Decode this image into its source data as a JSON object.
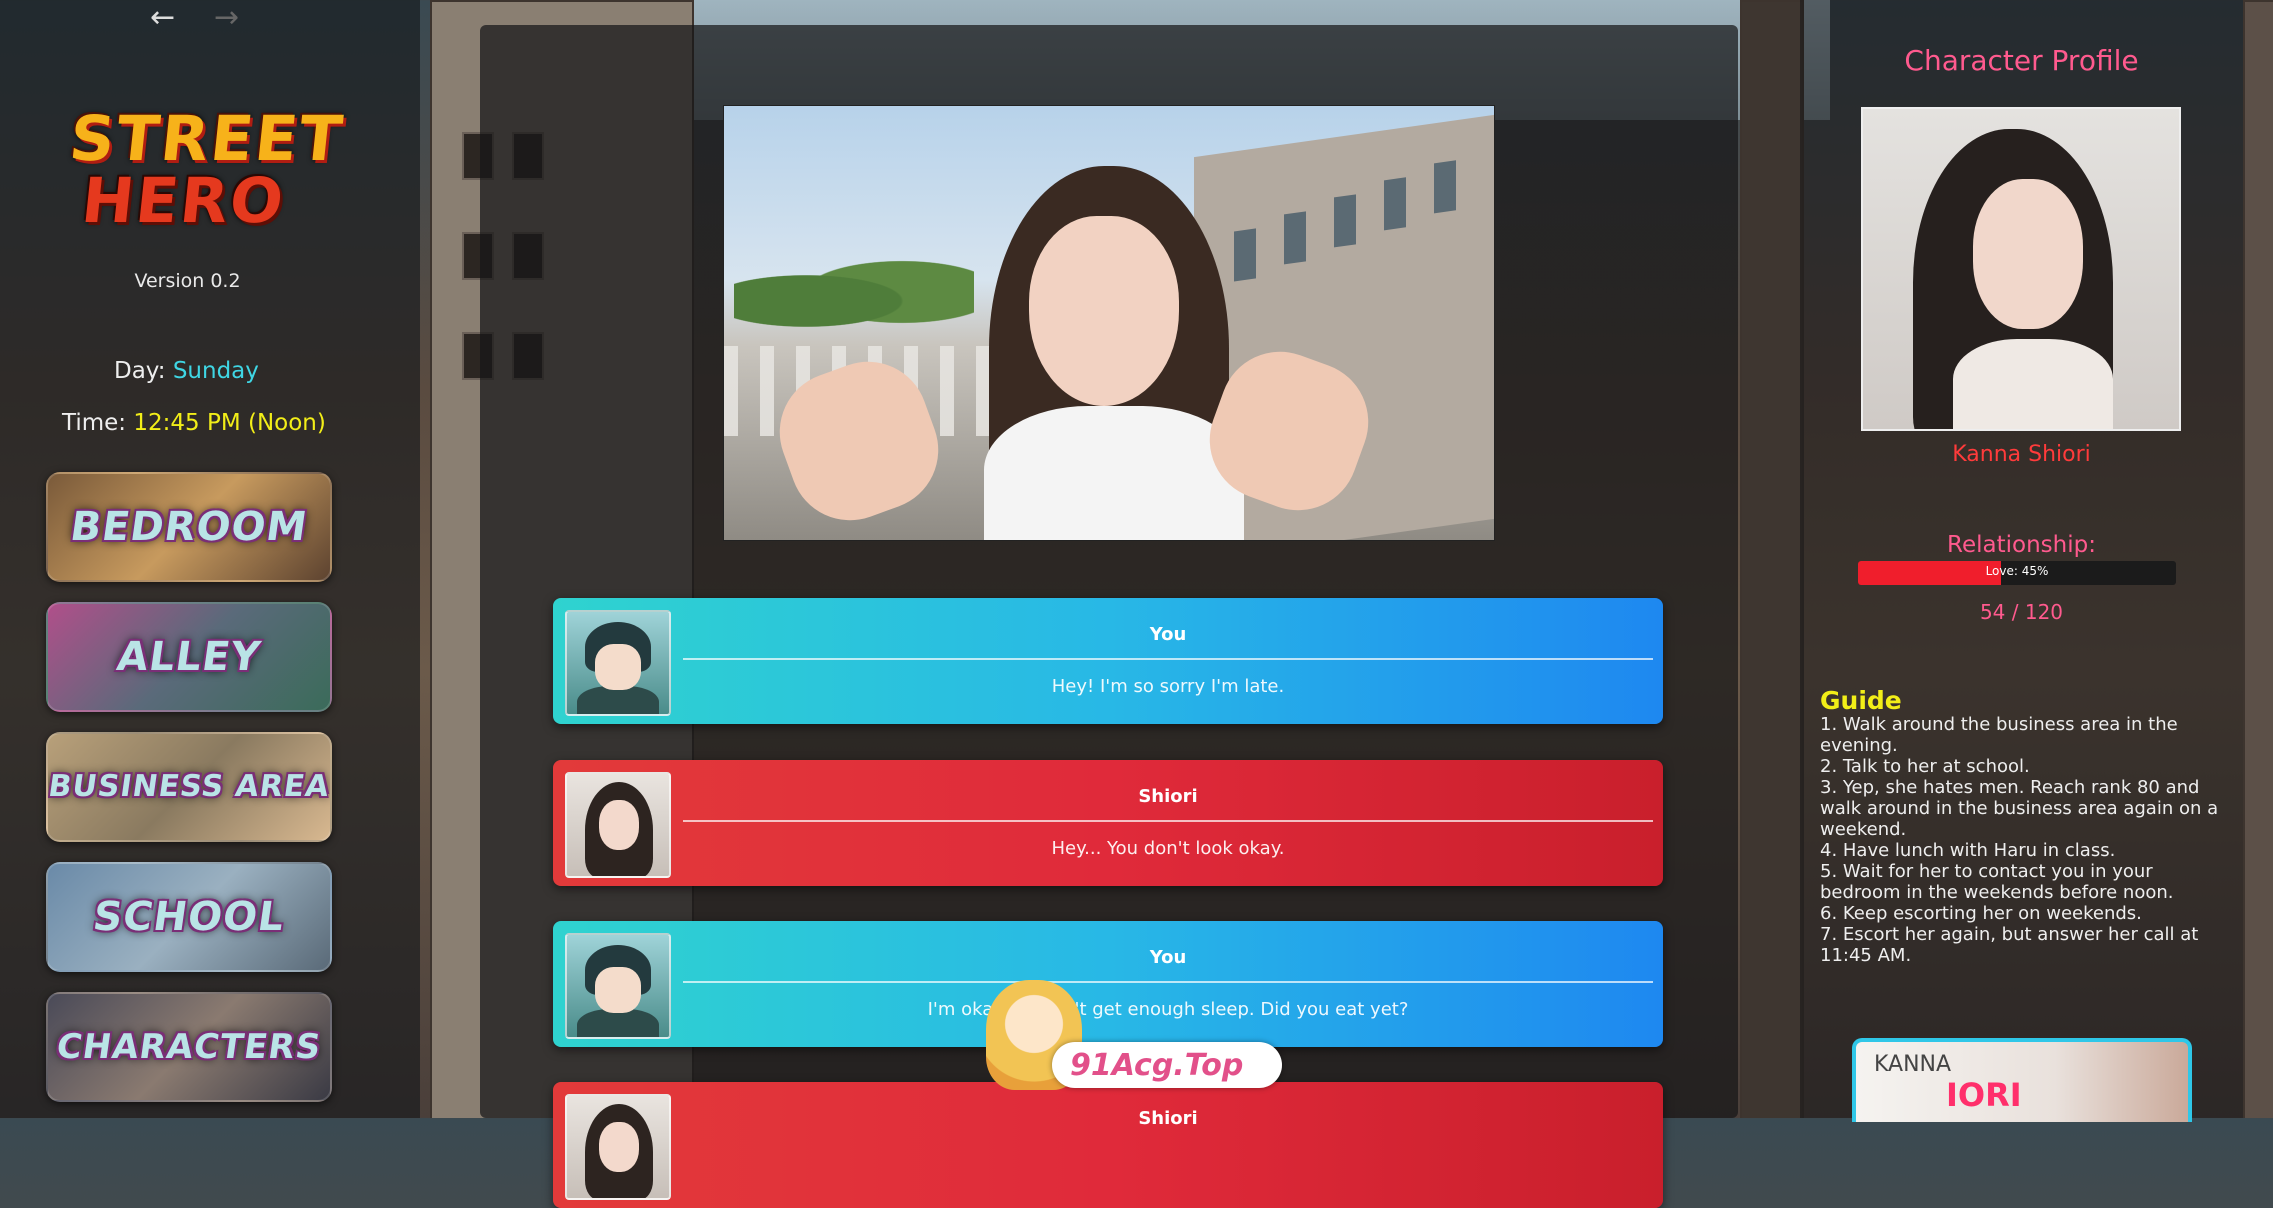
{
  "nav": {
    "back_icon": "arrow-left-icon",
    "forward_icon": "arrow-right-icon"
  },
  "logo": {
    "line1": "STREET",
    "line2": "HERO"
  },
  "version": "Version 0.2",
  "day": {
    "label": "Day:",
    "value": "Sunday"
  },
  "time": {
    "label": "Time:",
    "value": "12:45 PM (Noon)"
  },
  "locations": [
    {
      "label": "BEDROOM"
    },
    {
      "label": "ALLEY"
    },
    {
      "label": "BUSINESS AREA"
    },
    {
      "label": "SCHOOL"
    },
    {
      "label": "CHARACTERS"
    }
  ],
  "dialogue": [
    {
      "speaker": "You",
      "text": "Hey! I'm so sorry I'm late."
    },
    {
      "speaker": "Shiori",
      "text": "Hey... You don't look okay."
    },
    {
      "speaker": "You",
      "text": "I'm okay... I didn't get enough sleep. Did you eat yet?"
    },
    {
      "speaker": "Shiori",
      "text": ""
    }
  ],
  "profile": {
    "title": "Character Profile",
    "name": "Kanna Shiori",
    "relationship_label": "Relationship:",
    "relationship_bar_text": "Love: 45%",
    "relationship_fraction": 0.45,
    "relationship_count": "54 / 120"
  },
  "guide": {
    "title": "Guide",
    "steps": [
      "1. Walk around the business area in the evening.",
      "2. Talk to her at school.",
      "3. Yep, she hates men. Reach rank 80 and walk around in the business area again on a weekend.",
      "4. Have lunch with Haru in class.",
      "5. Wait for her to contact you in your bedroom in the weekends before noon.",
      "6. Keep escorting her on weekends.",
      "7. Escort her again, but answer her call at 11:45 AM."
    ]
  },
  "thumbnail": {
    "line1": "KANNA",
    "line2": "IORI"
  },
  "watermark": "91Acg.Top",
  "colors": {
    "you_bubble": "#28b8e6",
    "her_bubble": "#e02a3a",
    "accent_pink": "#ff5a8e",
    "day_value": "#3fd6e4",
    "time_value": "#f2ee18"
  }
}
